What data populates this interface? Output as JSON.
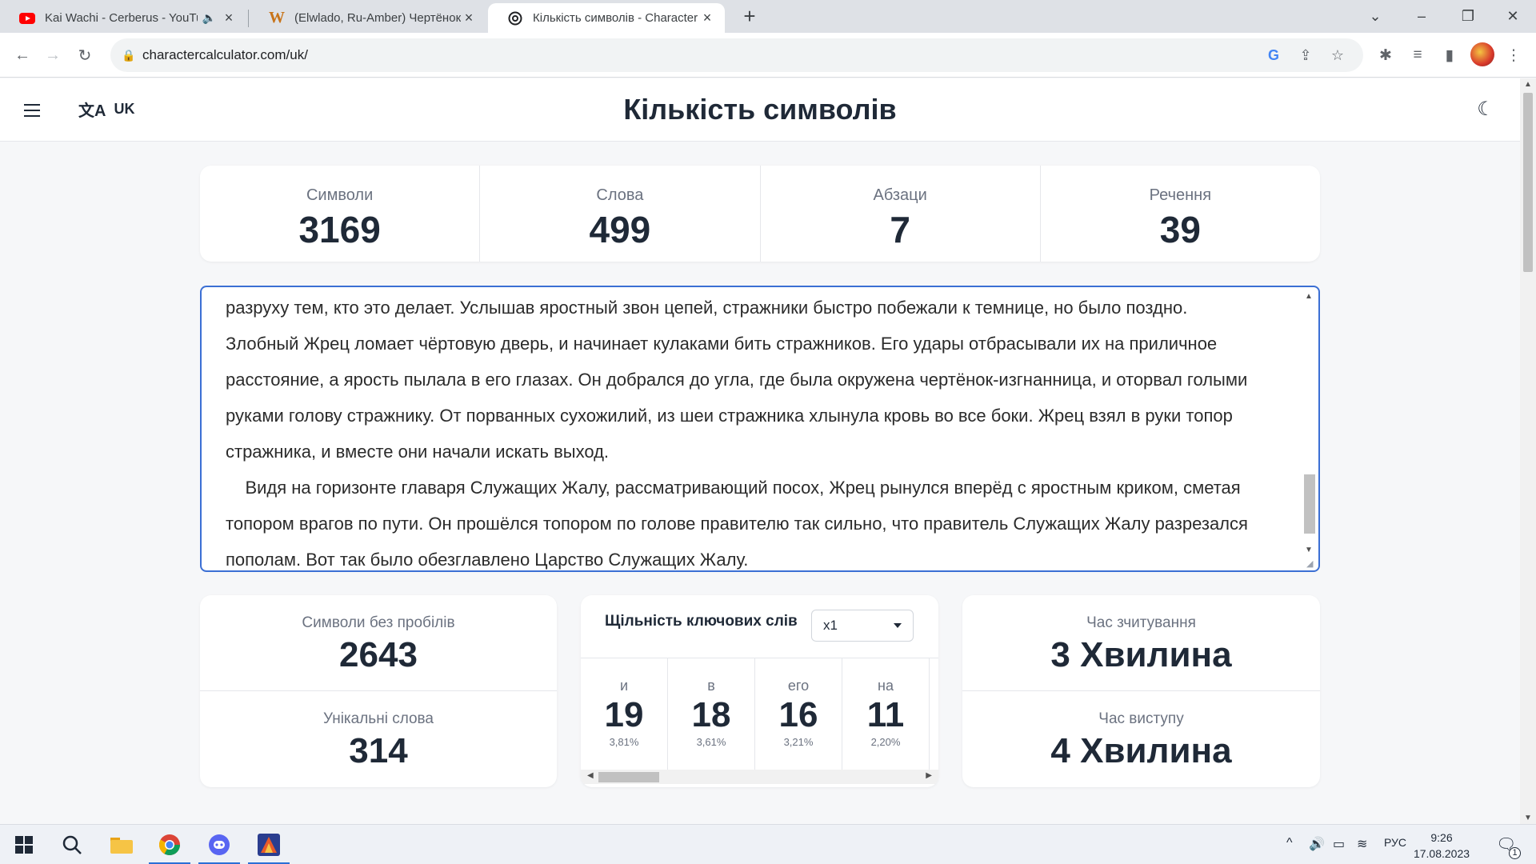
{
  "browser": {
    "tabs": [
      {
        "title": "Kai Wachi - Cerberus - YouTu",
        "favicon": "youtube-icon",
        "muted": true
      },
      {
        "title": "(Elwlado, Ru-Amber) Чертёнок-и",
        "favicon": "w-icon"
      },
      {
        "title": "Кількість символів - Character C",
        "favicon": "cc-icon",
        "active": true
      }
    ],
    "new_tab": "+",
    "url": "charactercalculator.com/uk/"
  },
  "header": {
    "lang": "UK",
    "title": "Кількість символів"
  },
  "stats": {
    "characters": {
      "label": "Символи",
      "value": "3169"
    },
    "words": {
      "label": "Слова",
      "value": "499"
    },
    "paragraphs": {
      "label": "Абзаци",
      "value": "7"
    },
    "sentences": {
      "label": "Речення",
      "value": "39"
    }
  },
  "editor": {
    "text": "разруху тем, кто это делает. Услышав яростный звон цепей, стражники быстро побежали к темнице, но было поздно.\nЗлобный Жрец ломает чёртовую дверь, и начинает кулаками бить стражников. Его удары отбрасывали их на приличное\nрасстояние, а ярость пылала в его глазах. Он добрался до угла, где была окружена чертёнок-изгнанница, и оторвал голыми\nруками голову стражнику. От порванных сухожилий, из шеи стражника хлынула кровь во все боки. Жрец взял в руки топор\nстражника, и вместе они начали искать выход.\n    Видя на горизонте главаря Служащих Жалу, рассматривающий посох, Жрец рынулся вперёд с яростным криком, сметая\nтопором врагов по пути. Он прошёлся топором по голове правителю так сильно, что правитель Служащих Жалу разрезался\nпополам. Вот так было обезглавлено Царство Служащих Жалу."
  },
  "extra": {
    "no_spaces": {
      "label": "Символи без пробілів",
      "value": "2643"
    },
    "unique_words": {
      "label": "Унікальні слова",
      "value": "314"
    },
    "reading_time": {
      "label": "Час зчитування",
      "value": "3 Хвилина"
    },
    "speaking_time": {
      "label": "Час виступу",
      "value": "4 Хвилина"
    }
  },
  "keyword_density": {
    "title": "Щільність ключових слів",
    "selected": "x1",
    "items": [
      {
        "word": "и",
        "count": "19",
        "percent": "3,81%"
      },
      {
        "word": "в",
        "count": "18",
        "percent": "3,61%"
      },
      {
        "word": "его",
        "count": "16",
        "percent": "3,21%"
      },
      {
        "word": "на",
        "count": "11",
        "percent": "2,20%"
      }
    ]
  },
  "taskbar": {
    "lang": "РУС",
    "time": "9:26",
    "date": "17.08.2023",
    "notifications": "1"
  },
  "colors": {
    "accent": "#3b6fd4",
    "youtube": "#ff0000",
    "w_favicon": "#c8741a"
  }
}
